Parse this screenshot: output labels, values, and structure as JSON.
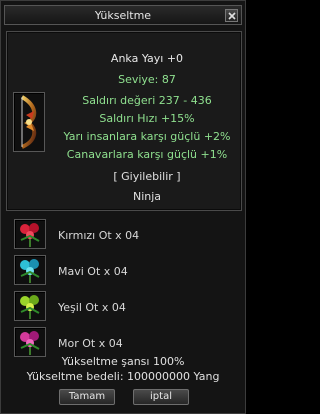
{
  "window": {
    "title": "Yükseltme"
  },
  "item": {
    "name": "Anka Yayı +0",
    "level": "Seviye: 87",
    "attack_value": "Saldırı değeri 237 - 436",
    "attack_speed": "Saldırı Hızı +15%",
    "vs_half_humans": "Yarı insanlara karşı güçlü +2%",
    "vs_monsters": "Canavarlara karşı güçlü +1%",
    "wearable": "[ Giyilebilir ]",
    "class": "Ninja",
    "icon": "phoenix-bow-icon"
  },
  "materials": [
    {
      "label": "Kırmızı Ot x 04",
      "icon": "red-herb-icon",
      "color": "#d8233a"
    },
    {
      "label": "Mavi Ot x 04",
      "icon": "blue-herb-icon",
      "color": "#2ec0d6"
    },
    {
      "label": "Yeşil Ot x 04",
      "icon": "green-herb-icon",
      "color": "#9ad42a"
    },
    {
      "label": "Mor Ot x 04",
      "icon": "purple-herb-icon",
      "color": "#d23a9a"
    }
  ],
  "upgrade": {
    "chance": "Yükseltme şansı 100%",
    "cost": "Yükseltme bedeli: 100000000 Yang"
  },
  "buttons": {
    "ok": "Tamam",
    "cancel": "iptal"
  },
  "colors": {
    "stat_green": "#8fe08f",
    "text": "#d8d8d8"
  }
}
